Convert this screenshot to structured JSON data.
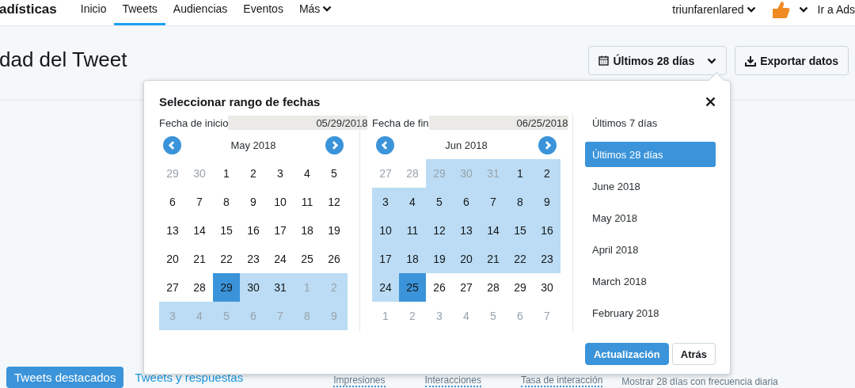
{
  "nav": {
    "brand": "adísticas",
    "items": [
      {
        "label": "Inicio",
        "selected": false
      },
      {
        "label": "Tweets",
        "selected": true
      },
      {
        "label": "Audiencias",
        "selected": false
      },
      {
        "label": "Eventos",
        "selected": false
      },
      {
        "label": "Más",
        "selected": false,
        "dropdown": true
      }
    ],
    "account": "triunfarenlared",
    "ads_link": "Ir a Ads"
  },
  "page_title": "dad del Tweet",
  "date_button": "Últimos 28 días",
  "export_button": "Exportar datos",
  "popup": {
    "title": "Seleccionar rango de fechas",
    "calendars": [
      {
        "field_label": "Fecha de inicio",
        "value": "05/29/2018",
        "month": "May 2018",
        "weeks": [
          [
            {
              "d": "29",
              "muted": true,
              "in_range": false,
              "selected": false
            },
            {
              "d": "30",
              "muted": true,
              "in_range": false,
              "selected": false
            },
            {
              "d": "1",
              "muted": false,
              "in_range": false,
              "selected": false
            },
            {
              "d": "2",
              "muted": false,
              "in_range": false,
              "selected": false
            },
            {
              "d": "3",
              "muted": false,
              "in_range": false,
              "selected": false
            },
            {
              "d": "4",
              "muted": false,
              "in_range": false,
              "selected": false
            },
            {
              "d": "5",
              "muted": false,
              "in_range": false,
              "selected": false
            }
          ],
          [
            {
              "d": "6",
              "muted": false,
              "in_range": false,
              "selected": false
            },
            {
              "d": "7",
              "muted": false,
              "in_range": false,
              "selected": false
            },
            {
              "d": "8",
              "muted": false,
              "in_range": false,
              "selected": false
            },
            {
              "d": "9",
              "muted": false,
              "in_range": false,
              "selected": false
            },
            {
              "d": "10",
              "muted": false,
              "in_range": false,
              "selected": false
            },
            {
              "d": "11",
              "muted": false,
              "in_range": false,
              "selected": false
            },
            {
              "d": "12",
              "muted": false,
              "in_range": false,
              "selected": false
            }
          ],
          [
            {
              "d": "13",
              "muted": false,
              "in_range": false,
              "selected": false
            },
            {
              "d": "14",
              "muted": false,
              "in_range": false,
              "selected": false
            },
            {
              "d": "15",
              "muted": false,
              "in_range": false,
              "selected": false
            },
            {
              "d": "16",
              "muted": false,
              "in_range": false,
              "selected": false
            },
            {
              "d": "17",
              "muted": false,
              "in_range": false,
              "selected": false
            },
            {
              "d": "18",
              "muted": false,
              "in_range": false,
              "selected": false
            },
            {
              "d": "19",
              "muted": false,
              "in_range": false,
              "selected": false
            }
          ],
          [
            {
              "d": "20",
              "muted": false,
              "in_range": false,
              "selected": false
            },
            {
              "d": "21",
              "muted": false,
              "in_range": false,
              "selected": false
            },
            {
              "d": "22",
              "muted": false,
              "in_range": false,
              "selected": false
            },
            {
              "d": "23",
              "muted": false,
              "in_range": false,
              "selected": false
            },
            {
              "d": "24",
              "muted": false,
              "in_range": false,
              "selected": false
            },
            {
              "d": "25",
              "muted": false,
              "in_range": false,
              "selected": false
            },
            {
              "d": "26",
              "muted": false,
              "in_range": false,
              "selected": false
            }
          ],
          [
            {
              "d": "27",
              "muted": false,
              "in_range": false,
              "selected": false
            },
            {
              "d": "28",
              "muted": false,
              "in_range": false,
              "selected": false
            },
            {
              "d": "29",
              "muted": false,
              "in_range": true,
              "selected": true
            },
            {
              "d": "30",
              "muted": false,
              "in_range": true,
              "selected": false
            },
            {
              "d": "31",
              "muted": false,
              "in_range": true,
              "selected": false
            },
            {
              "d": "1",
              "muted": true,
              "in_range": true,
              "selected": false
            },
            {
              "d": "2",
              "muted": true,
              "in_range": true,
              "selected": false
            }
          ],
          [
            {
              "d": "3",
              "muted": true,
              "in_range": true,
              "selected": false
            },
            {
              "d": "4",
              "muted": true,
              "in_range": true,
              "selected": false
            },
            {
              "d": "5",
              "muted": true,
              "in_range": true,
              "selected": false
            },
            {
              "d": "6",
              "muted": true,
              "in_range": true,
              "selected": false
            },
            {
              "d": "7",
              "muted": true,
              "in_range": true,
              "selected": false
            },
            {
              "d": "8",
              "muted": true,
              "in_range": true,
              "selected": false
            },
            {
              "d": "9",
              "muted": true,
              "in_range": true,
              "selected": false
            }
          ]
        ]
      },
      {
        "field_label": "Fecha de fin",
        "value": "06/25/2018",
        "month": "Jun 2018",
        "weeks": [
          [
            {
              "d": "27",
              "muted": true,
              "in_range": false,
              "selected": false
            },
            {
              "d": "28",
              "muted": true,
              "in_range": false,
              "selected": false
            },
            {
              "d": "29",
              "muted": true,
              "in_range": true,
              "selected": false
            },
            {
              "d": "30",
              "muted": true,
              "in_range": true,
              "selected": false
            },
            {
              "d": "31",
              "muted": true,
              "in_range": true,
              "selected": false
            },
            {
              "d": "1",
              "muted": false,
              "in_range": true,
              "selected": false
            },
            {
              "d": "2",
              "muted": false,
              "in_range": true,
              "selected": false
            }
          ],
          [
            {
              "d": "3",
              "muted": false,
              "in_range": true,
              "selected": false
            },
            {
              "d": "4",
              "muted": false,
              "in_range": true,
              "selected": false
            },
            {
              "d": "5",
              "muted": false,
              "in_range": true,
              "selected": false
            },
            {
              "d": "6",
              "muted": false,
              "in_range": true,
              "selected": false
            },
            {
              "d": "7",
              "muted": false,
              "in_range": true,
              "selected": false
            },
            {
              "d": "8",
              "muted": false,
              "in_range": true,
              "selected": false
            },
            {
              "d": "9",
              "muted": false,
              "in_range": true,
              "selected": false
            }
          ],
          [
            {
              "d": "10",
              "muted": false,
              "in_range": true,
              "selected": false
            },
            {
              "d": "11",
              "muted": false,
              "in_range": true,
              "selected": false
            },
            {
              "d": "12",
              "muted": false,
              "in_range": true,
              "selected": false
            },
            {
              "d": "13",
              "muted": false,
              "in_range": true,
              "selected": false
            },
            {
              "d": "14",
              "muted": false,
              "in_range": true,
              "selected": false
            },
            {
              "d": "15",
              "muted": false,
              "in_range": true,
              "selected": false
            },
            {
              "d": "16",
              "muted": false,
              "in_range": true,
              "selected": false
            }
          ],
          [
            {
              "d": "17",
              "muted": false,
              "in_range": true,
              "selected": false
            },
            {
              "d": "18",
              "muted": false,
              "in_range": true,
              "selected": false
            },
            {
              "d": "19",
              "muted": false,
              "in_range": true,
              "selected": false
            },
            {
              "d": "20",
              "muted": false,
              "in_range": true,
              "selected": false
            },
            {
              "d": "21",
              "muted": false,
              "in_range": true,
              "selected": false
            },
            {
              "d": "22",
              "muted": false,
              "in_range": true,
              "selected": false
            },
            {
              "d": "23",
              "muted": false,
              "in_range": true,
              "selected": false
            }
          ],
          [
            {
              "d": "24",
              "muted": false,
              "in_range": true,
              "selected": false
            },
            {
              "d": "25",
              "muted": false,
              "in_range": true,
              "selected": true
            },
            {
              "d": "26",
              "muted": false,
              "in_range": false,
              "selected": false
            },
            {
              "d": "27",
              "muted": false,
              "in_range": false,
              "selected": false
            },
            {
              "d": "28",
              "muted": false,
              "in_range": false,
              "selected": false
            },
            {
              "d": "29",
              "muted": false,
              "in_range": false,
              "selected": false
            },
            {
              "d": "30",
              "muted": false,
              "in_range": false,
              "selected": false
            }
          ],
          [
            {
              "d": "1",
              "muted": true,
              "in_range": false,
              "selected": false
            },
            {
              "d": "2",
              "muted": true,
              "in_range": false,
              "selected": false
            },
            {
              "d": "3",
              "muted": true,
              "in_range": false,
              "selected": false
            },
            {
              "d": "4",
              "muted": true,
              "in_range": false,
              "selected": false
            },
            {
              "d": "5",
              "muted": true,
              "in_range": false,
              "selected": false
            },
            {
              "d": "6",
              "muted": true,
              "in_range": false,
              "selected": false
            },
            {
              "d": "7",
              "muted": true,
              "in_range": false,
              "selected": false
            }
          ]
        ]
      }
    ],
    "presets": [
      {
        "label": "Últimos 7 días",
        "selected": false
      },
      {
        "label": "Últimos 28 días",
        "selected": true
      },
      {
        "label": "June 2018",
        "selected": false
      },
      {
        "label": "May 2018",
        "selected": false
      },
      {
        "label": "April 2018",
        "selected": false
      },
      {
        "label": "March 2018",
        "selected": false
      },
      {
        "label": "February 2018",
        "selected": false
      }
    ],
    "update_button": "Actualización",
    "back_button": "Atrás"
  },
  "tweet_tabs": [
    {
      "label": "Tweets destacados",
      "selected": true
    },
    {
      "label": "Tweets y respuestas",
      "selected": false
    }
  ],
  "metric_tabs": [
    "Impresiones",
    "Interacciones",
    "Tasa de interacción"
  ],
  "chart_note": "Mostrar 28 días con frecuencia diaria"
}
